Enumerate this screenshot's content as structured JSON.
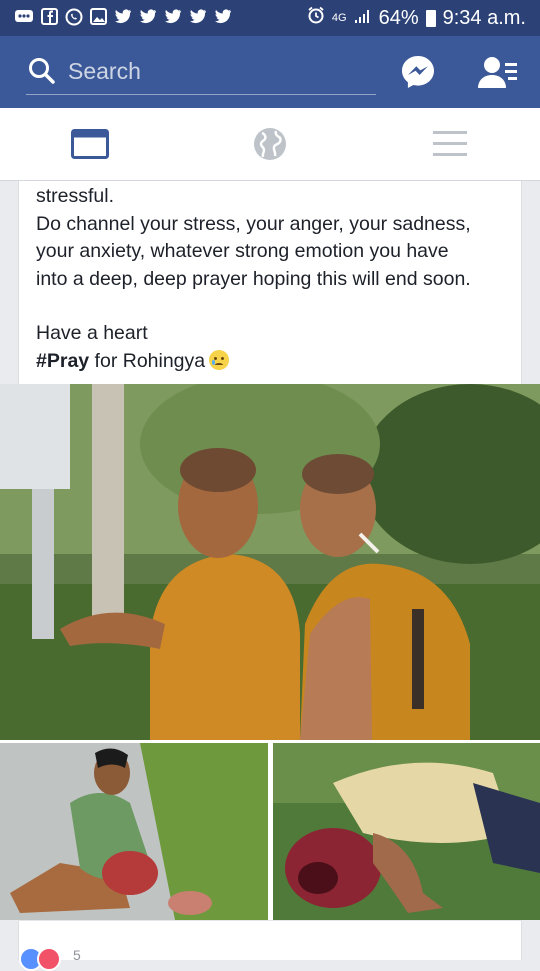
{
  "status_bar": {
    "network": "4G",
    "battery": "64%",
    "time": "9:34 a.m.",
    "icons": [
      "chat-icon",
      "facebook-icon",
      "whatsapp-icon",
      "gallery-icon",
      "twitter-icon",
      "twitter-icon",
      "twitter-icon",
      "twitter-icon",
      "twitter-icon",
      "alarm-icon",
      "signal-icon",
      "battery-icon"
    ]
  },
  "header": {
    "search_placeholder": "Search",
    "colors": {
      "app_bar": "#3b5998",
      "status_bar": "#2c4276"
    }
  },
  "tabs": [
    {
      "name": "news-feed",
      "icon": "news-feed-icon",
      "active": true
    },
    {
      "name": "notifications",
      "icon": "globe-icon",
      "active": false
    },
    {
      "name": "menu",
      "icon": "menu-icon",
      "active": false
    }
  ],
  "post": {
    "line_1": "stressful.",
    "line_2": "Do channel your stress, your anger, your sadness,",
    "line_3": "your anxiety, whatever strong emotion you have",
    "line_4": "into a deep, deep prayer hoping this will end soon.",
    "line_5": "Have a heart",
    "hashtag": "#Pray",
    "line_6_rest": " for Rohingya",
    "emoji": "crying-face-emoji"
  },
  "reactions": {
    "types": [
      "like",
      "love"
    ],
    "count": "5"
  }
}
